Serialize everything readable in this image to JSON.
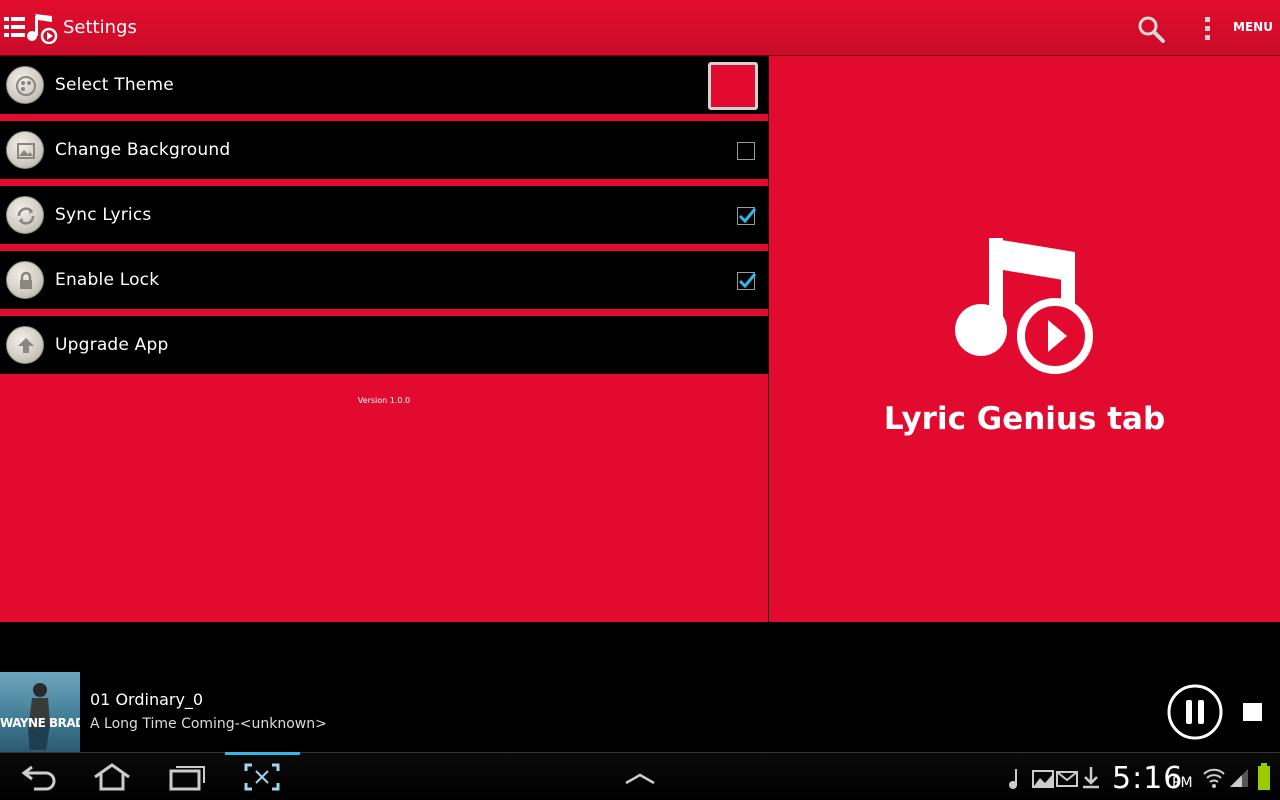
{
  "action_bar": {
    "title": "Settings",
    "menu_label": "MENU"
  },
  "settings": {
    "items": [
      {
        "label": "Select Theme",
        "control": "swatch"
      },
      {
        "label": "Change Background",
        "control": "checkbox",
        "checked": false
      },
      {
        "label": "Sync Lyrics",
        "control": "checkbox",
        "checked": true
      },
      {
        "label": "Enable Lock",
        "control": "checkbox",
        "checked": true
      },
      {
        "label": "Upgrade App",
        "control": "none"
      }
    ],
    "version": "Version 1.0.0"
  },
  "right_pane": {
    "title": "Lyric Genius tab"
  },
  "now_playing": {
    "album_text": "WAYNE BRADY",
    "track_title": "01 Ordinary_0",
    "track_subtitle": "A Long Time Coming-<unknown>"
  },
  "status_bar": {
    "time": "5:16",
    "ampm": "PM"
  },
  "colors": {
    "accent": "#e20a2e",
    "check": "#33b5e5"
  }
}
